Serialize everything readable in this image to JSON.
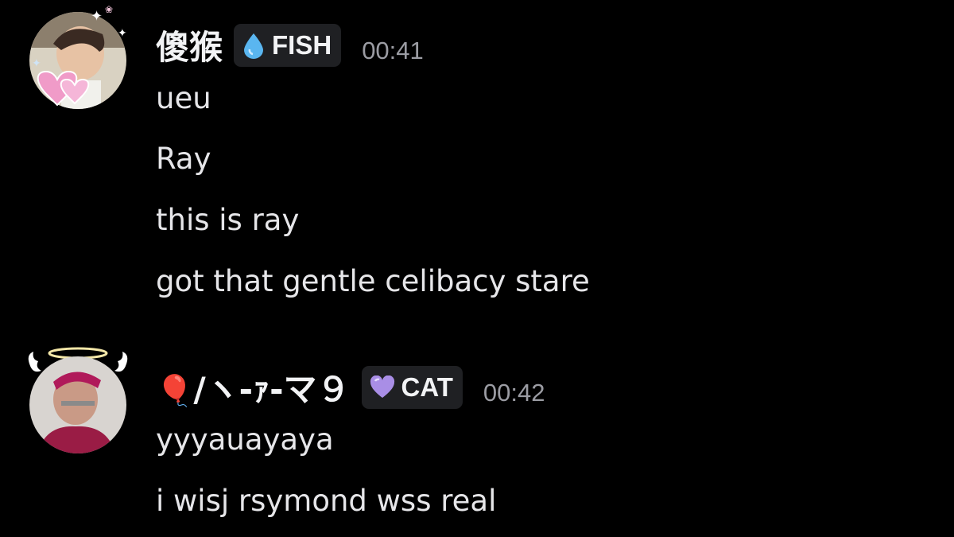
{
  "messages": [
    {
      "author": "傻猴",
      "tag": {
        "label": "FISH",
        "icon": "water-drop-icon",
        "icon_color": "#5ab6f0"
      },
      "time": "00:41",
      "lines": [
        "ueu",
        "Ray",
        "this is ray",
        "got that gentle celibacy stare"
      ]
    },
    {
      "author_emoji": "🎈",
      "author": "/ヽ-ｧ-マ９",
      "tag": {
        "label": "CAT",
        "icon": "purple-heart-icon",
        "icon_color": "#a98ee6"
      },
      "time": "00:42",
      "lines": [
        "yyyauayaya",
        "i wisj rsymond wss real"
      ]
    }
  ],
  "colors": {
    "background": "#000000",
    "username": "#f2f3f5",
    "message_text": "#e6e6e9",
    "timestamp": "#9b9ca3",
    "tag_background": "#1f2023"
  }
}
